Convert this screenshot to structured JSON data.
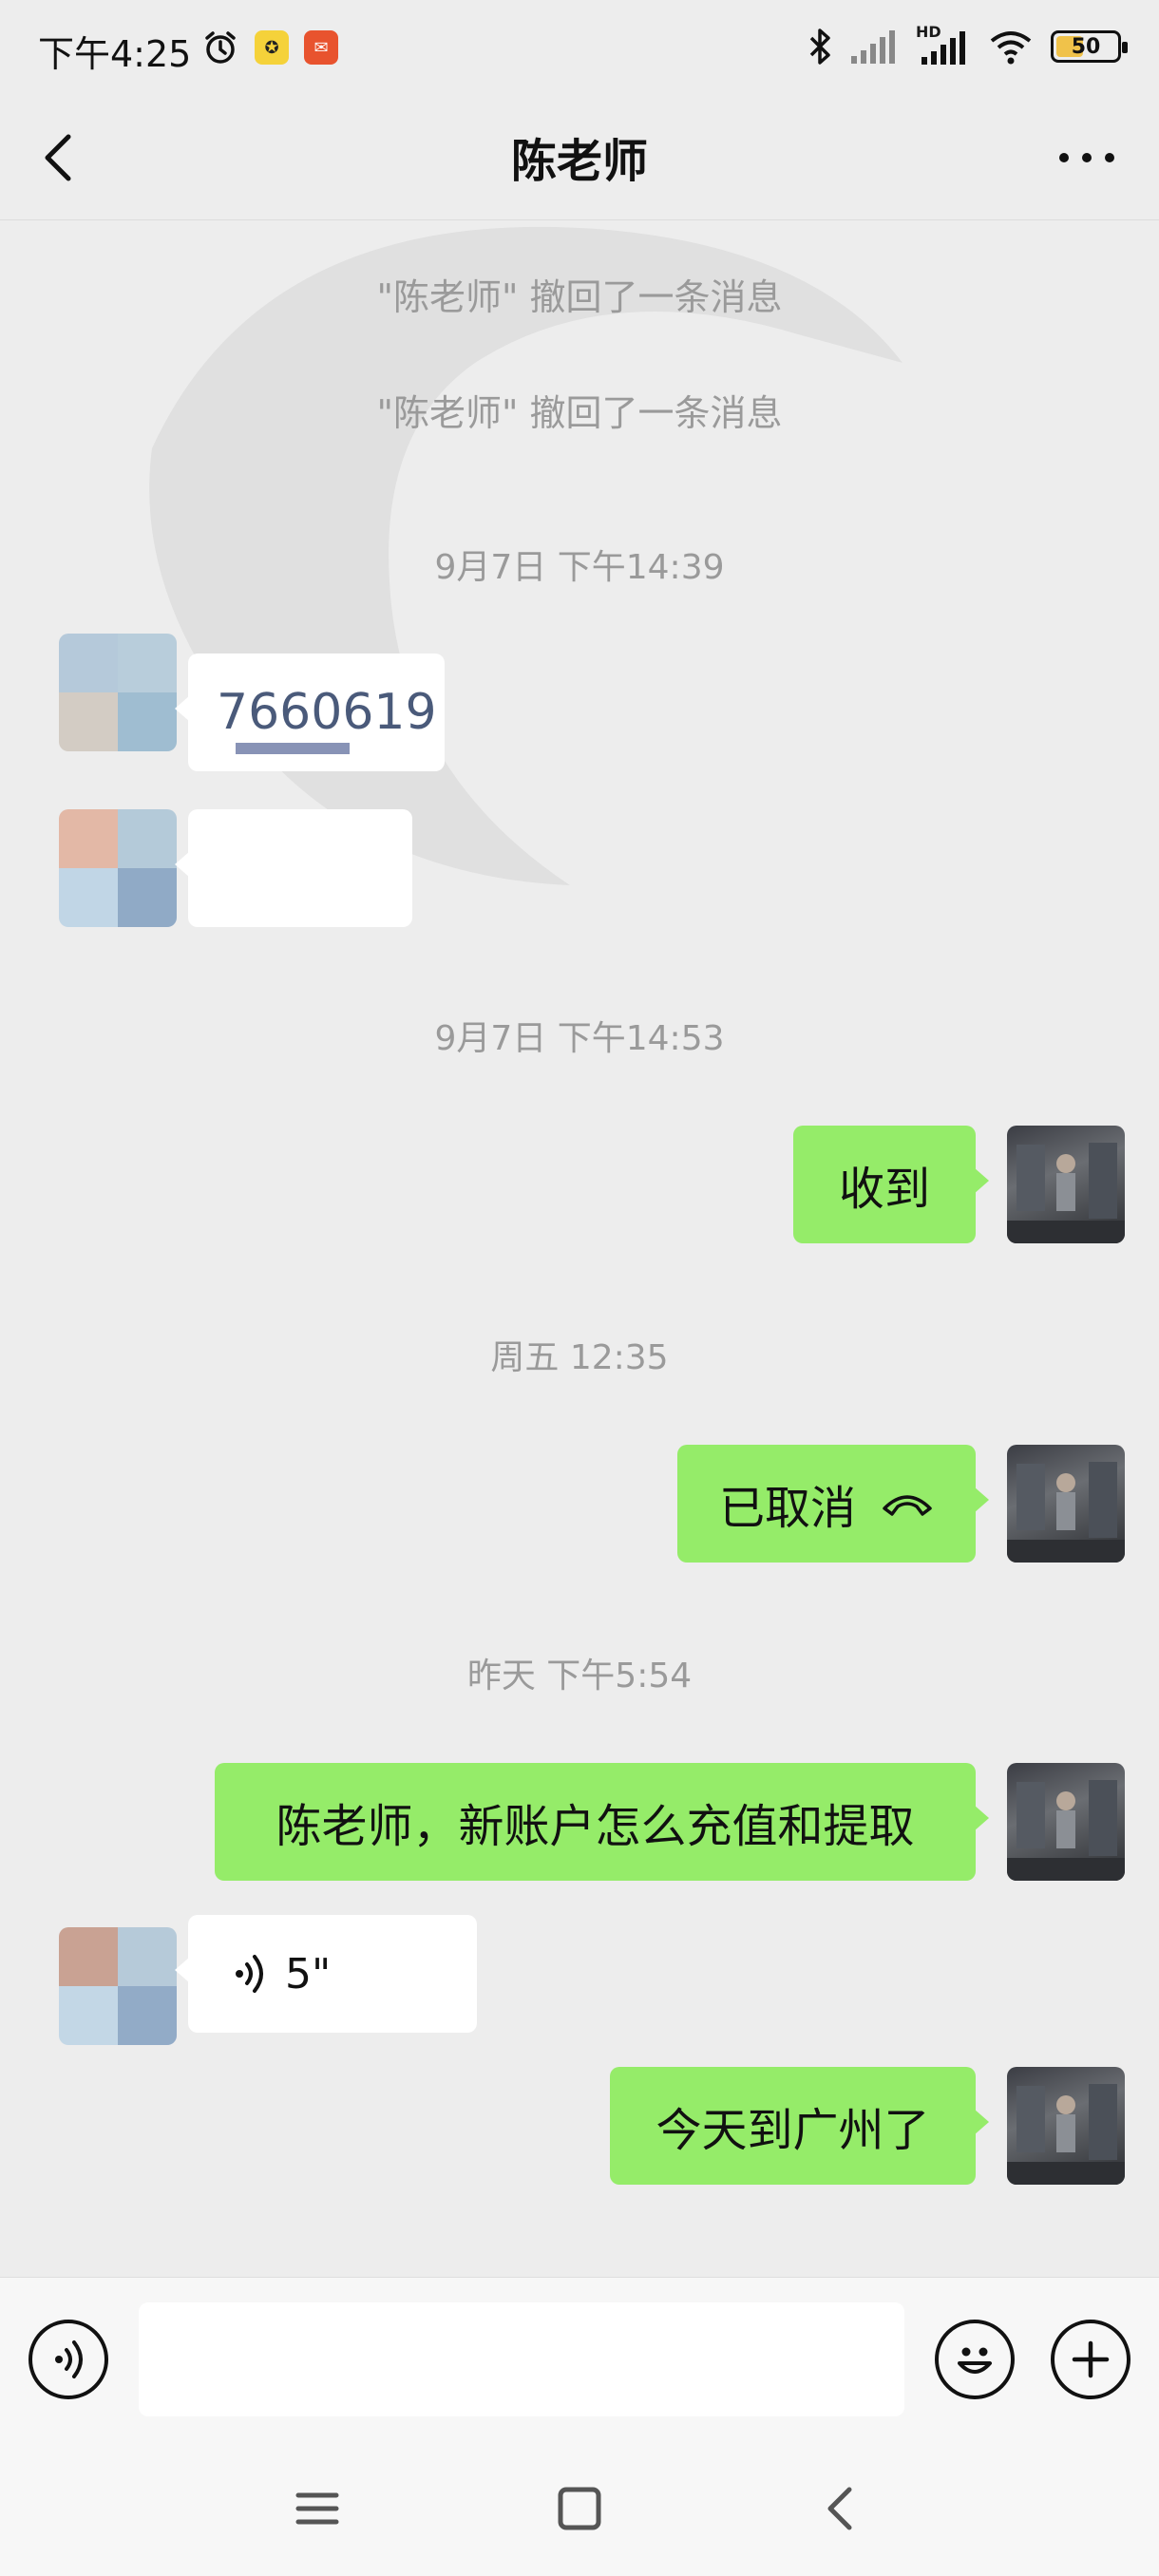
{
  "status_bar": {
    "time": "下午4:25",
    "signal_label": "HD",
    "battery": "50",
    "battery_level": 0.5
  },
  "header": {
    "title": "陈老师",
    "back_icon": "chevron-left-icon",
    "more_icon": "more-dots-icon"
  },
  "messages": {
    "recall_1": "\"陈老师\" 撤回了一条消息",
    "recall_2": "\"陈老师\" 撤回了一条消息",
    "time_1": "9月7日 下午14:39",
    "in_text_1": "7660619",
    "time_2": "9月7日 下午14:53",
    "out_1": "收到",
    "time_3": "周五 12:35",
    "out_2": "已取消",
    "time_4": "昨天 下午5:54",
    "out_3": "陈老师，新账户怎么充值和提取",
    "voice_duration": "5\"",
    "out_4": "今天到广州了"
  },
  "input_bar": {
    "voice_icon": "voice-toggle-icon",
    "emoji_icon": "emoji-icon",
    "plus_icon": "plus-icon",
    "placeholder": ""
  },
  "colors": {
    "background": "#ededed",
    "outgoing_bubble": "#95ec69",
    "incoming_bubble": "#ffffff",
    "system_text": "#9a9a9a"
  }
}
